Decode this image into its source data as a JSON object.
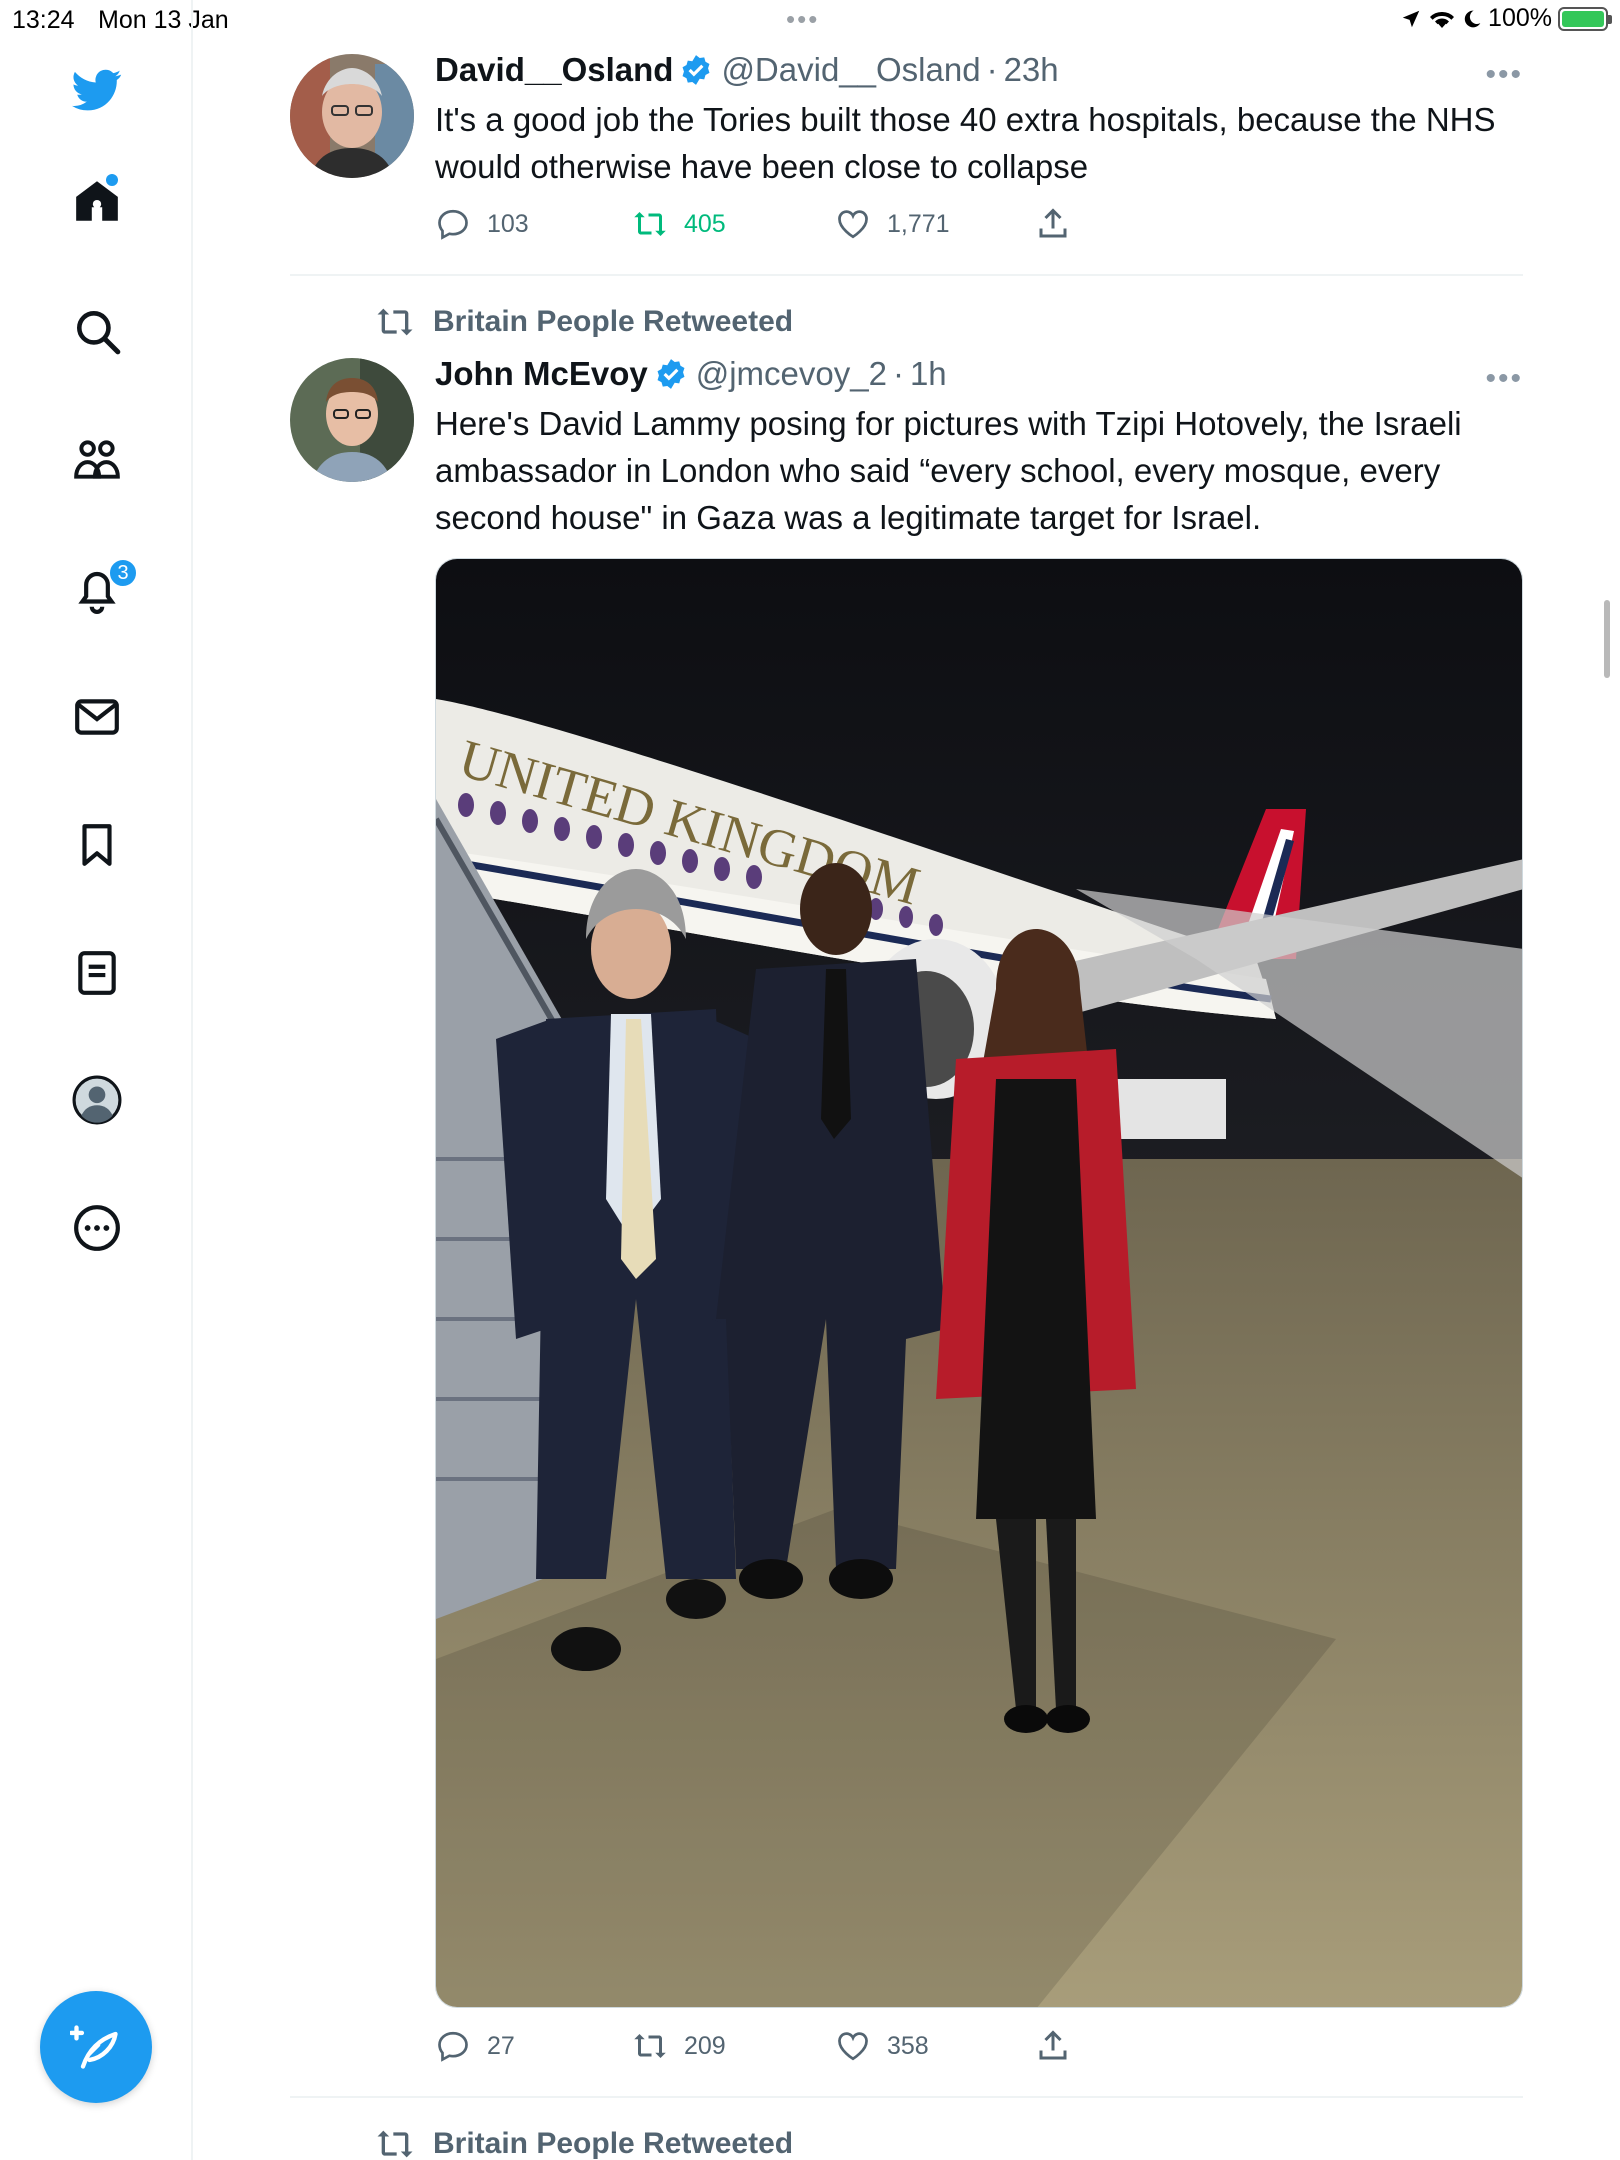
{
  "status_bar": {
    "time": "13:24",
    "date": "Mon 13 Jan",
    "battery": "100%"
  },
  "nav": {
    "notification_count": "3",
    "items": [
      "twitter-logo",
      "home-icon",
      "search-icon",
      "communities-icon",
      "notifications-icon",
      "messages-icon",
      "bookmarks-icon",
      "lists-icon",
      "profile-icon",
      "more-icon"
    ]
  },
  "tweets": [
    {
      "name": "David__Osland",
      "handle": "@David__Osland",
      "time": "23h",
      "text": "It's a good job the Tories built those 40 extra hospitals, because the NHS would otherwise have been close to collapse",
      "replies": "103",
      "retweets": "405",
      "likes": "1,771"
    },
    {
      "retweeted_by": "Britain People Retweeted",
      "name": "John McEvoy",
      "handle": "@jmcevoy_2",
      "time": "1h",
      "text": "Here's David Lammy posing for pictures with Tzipi Hotovely, the Israeli ambassador in London who said “every school, every mosque, every second house\" in Gaza was a legitimate target for Israel.",
      "image_text": "UNITED KINGDOM",
      "replies": "27",
      "retweets": "209",
      "likes": "358"
    },
    {
      "retweeted_by": "Britain People Retweeted"
    }
  ],
  "colors": {
    "accent": "#1d9bf0",
    "retweet_active": "#00ba7c",
    "secondary_text": "#536471"
  }
}
